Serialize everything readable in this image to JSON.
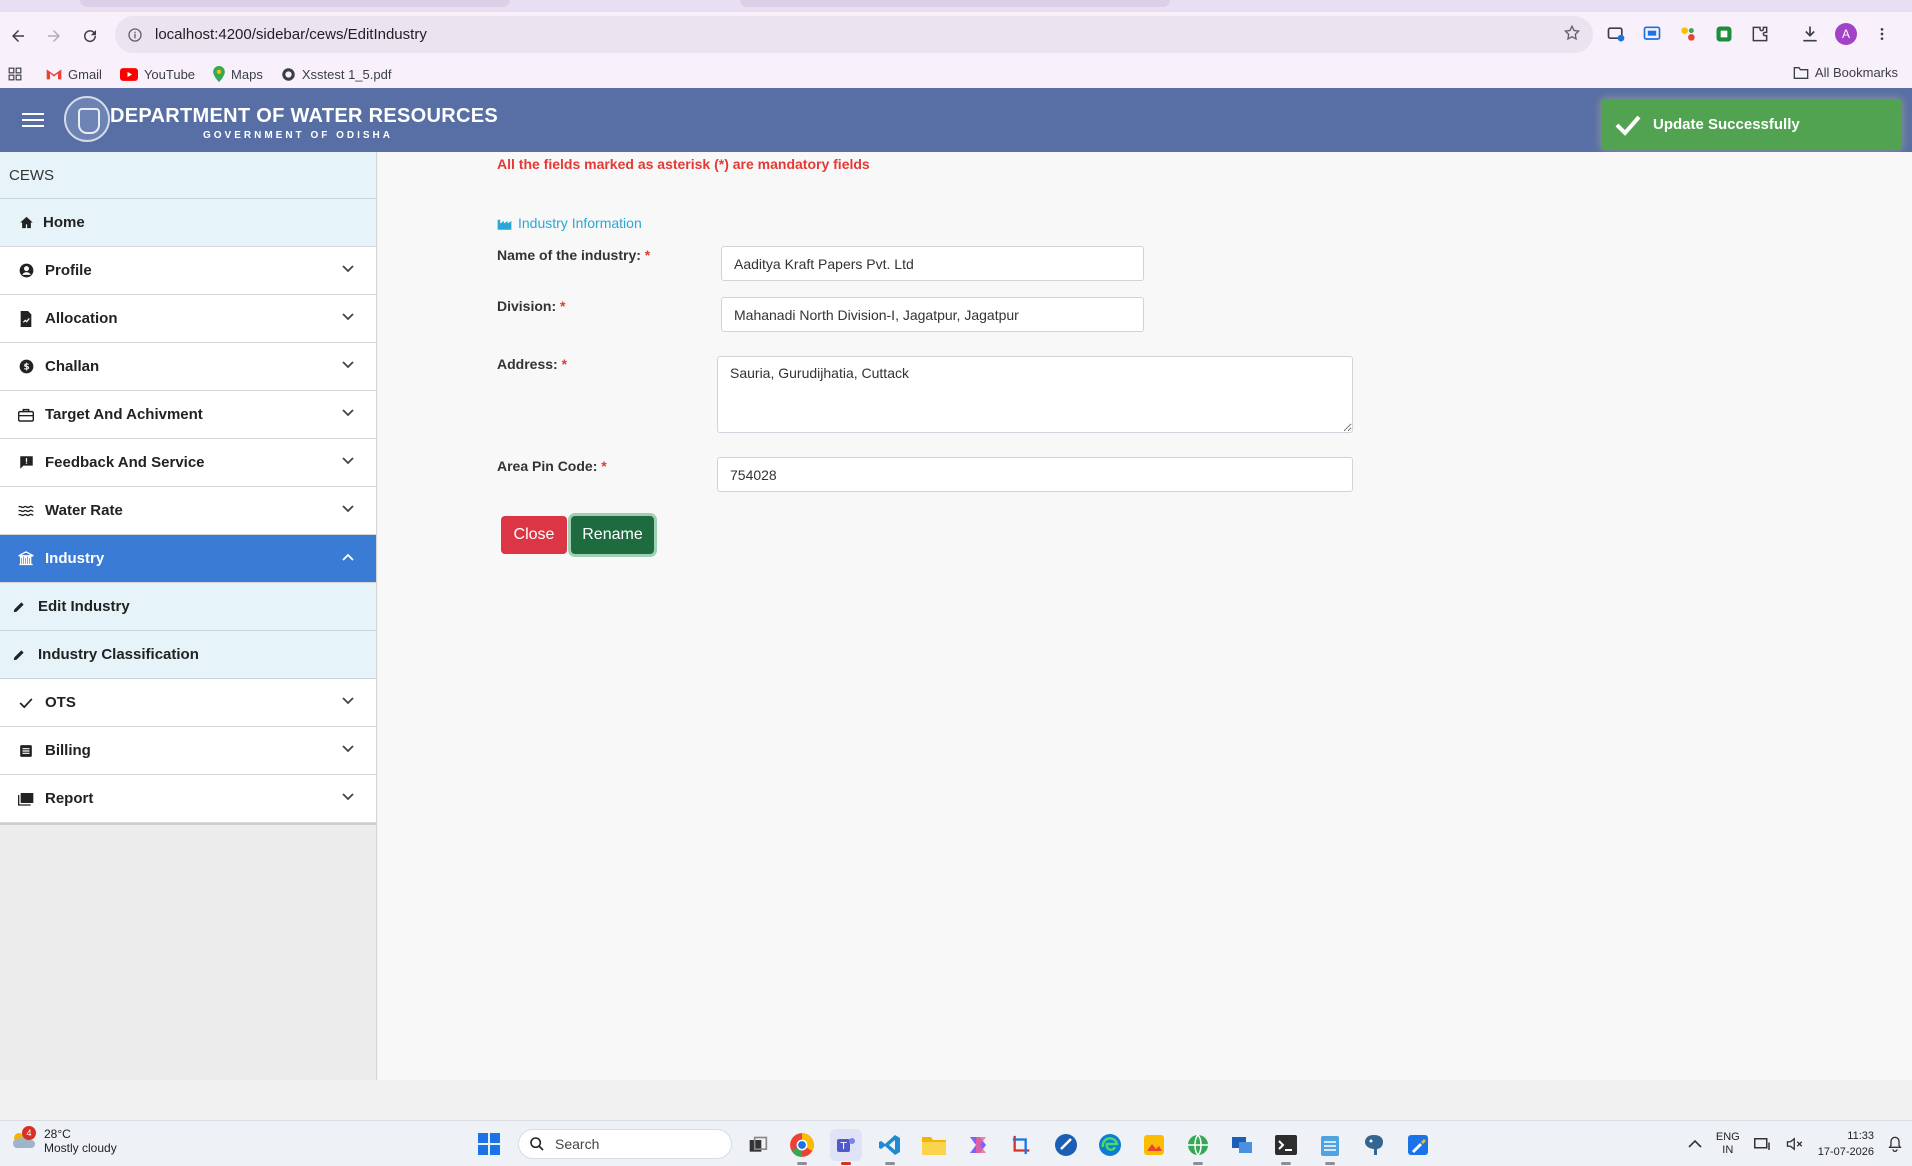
{
  "browser": {
    "url": "localhost:4200/sidebar/cews/EditIndustry",
    "bookmarks": [
      {
        "label": "Gmail",
        "icon": "gmail-icon"
      },
      {
        "label": "YouTube",
        "icon": "youtube-icon"
      },
      {
        "label": "Maps",
        "icon": "maps-icon"
      },
      {
        "label": "Xsstest 1_5.pdf",
        "icon": "pdf-icon"
      }
    ],
    "all_bookmarks": "All Bookmarks",
    "profile_initial": "A"
  },
  "header": {
    "title": "DEPARTMENT OF WATER RESOURCES",
    "subtitle": "GOVERNMENT OF ODISHA",
    "color": "#576fa4"
  },
  "toast": {
    "message": "Update Successfully",
    "color": "#51a351"
  },
  "sidebar": {
    "section": "CEWS",
    "items": [
      {
        "label": "Home"
      },
      {
        "label": "Profile"
      },
      {
        "label": "Allocation"
      },
      {
        "label": "Challan"
      },
      {
        "label": "Target And Achivment"
      },
      {
        "label": "Feedback And Service"
      },
      {
        "label": "Water Rate"
      },
      {
        "label": "Industry",
        "active": true
      },
      {
        "label": "OTS"
      },
      {
        "label": "Billing"
      },
      {
        "label": "Report"
      }
    ],
    "industry_sub": [
      {
        "label": "Edit Industry"
      },
      {
        "label": "Industry Classification"
      }
    ],
    "active_color": "#3a7bd5"
  },
  "form": {
    "mandatory_note": "All the fields marked as asterisk (*) are mandatory fields",
    "section_title": "Industry Information",
    "asterisk": "*",
    "fields": {
      "name": {
        "label": "Name of the industry:",
        "value": "Aaditya Kraft Papers Pvt. Ltd"
      },
      "division": {
        "label": "Division:",
        "value": "Mahanadi North Division-I, Jagatpur, Jagatpur"
      },
      "address": {
        "label": "Address:",
        "value": "Sauria, Gurudijhatia, Cuttack"
      },
      "pin": {
        "label": "Area Pin Code:",
        "value": "754028"
      }
    },
    "buttons": {
      "close": "Close",
      "rename": "Rename"
    }
  },
  "taskbar": {
    "weather_temp": "28°C",
    "weather_desc": "Mostly cloudy",
    "weather_badge": "4",
    "search_placeholder": "Search",
    "lang_top": "ENG",
    "lang_bottom": "IN",
    "time": "11:33",
    "date": "17-07-2026"
  }
}
